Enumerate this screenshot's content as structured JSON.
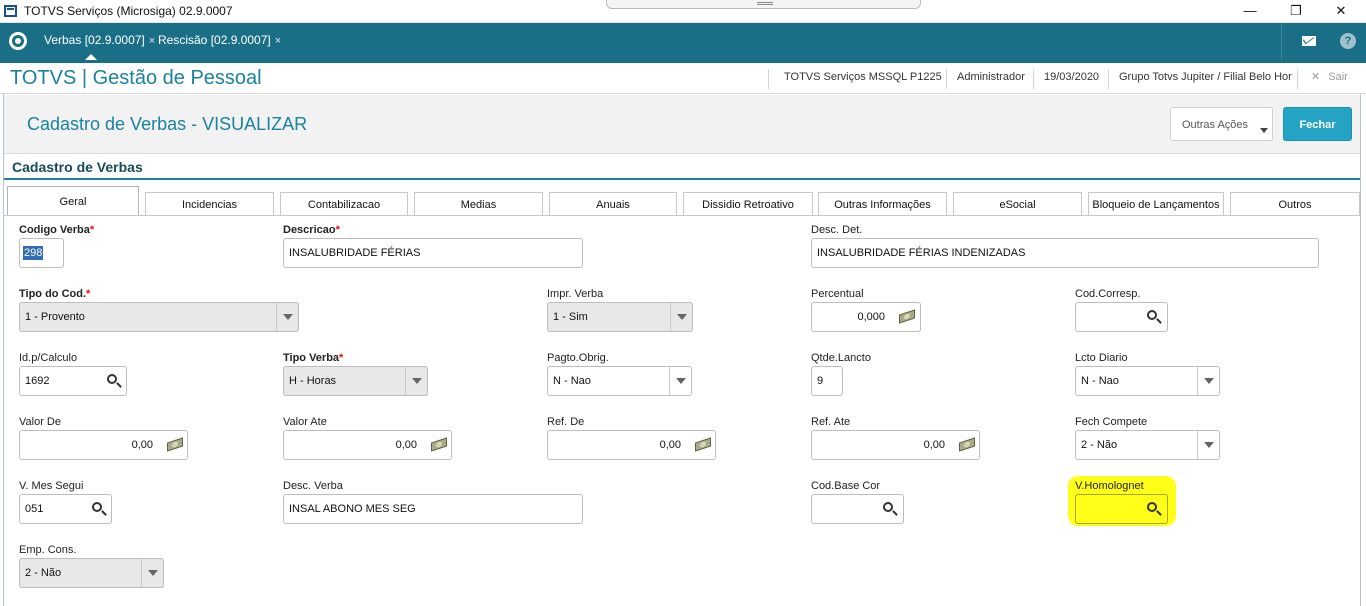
{
  "window": {
    "title": "TOTVS Serviços (Microsiga) 02.9.0007",
    "min": "—",
    "restore": "❐",
    "close": "✕"
  },
  "appbar": {
    "tabs": [
      {
        "label": "Verbas [02.9.0007]",
        "close": "×"
      },
      {
        "label": "Rescisão [02.9.0007]",
        "close": "×"
      }
    ],
    "help": "?"
  },
  "module": {
    "title": "TOTVS | Gestão de Pessoal",
    "server": "TOTVS Serviços MSSQL P1225",
    "user": "Administrador",
    "date": "19/03/2020",
    "branch": "Grupo Totvs Jupiter / Filial Belo Hor",
    "exit": "Sair",
    "exit_icon": "✕"
  },
  "page": {
    "title": "Cadastro de Verbas - VISUALIZAR",
    "other_actions": "Outras Ações",
    "close_button": "Fechar",
    "section": "Cadastro de Verbas"
  },
  "tabs": [
    "Geral",
    "Incidencias",
    "Contabilizacao",
    "Medias",
    "Anuais",
    "Dissidio Retroativo",
    "Outras Informações",
    "eSocial",
    "Bloqueio de Lançamentos",
    "Outros"
  ],
  "required_mark": "*",
  "fields": {
    "codigo_verba": {
      "label": "Codigo Verba",
      "value": "298"
    },
    "descricao": {
      "label": "Descricao",
      "value": "INSALUBRIDADE FÉRIAS"
    },
    "desc_det": {
      "label": "Desc. Det.",
      "value": "INSALUBRIDADE FÉRIAS INDENIZADAS"
    },
    "tipo_cod": {
      "label": "Tipo do Cod.",
      "value": "1 - Provento"
    },
    "impr_verba": {
      "label": "Impr. Verba",
      "value": "1 - Sim"
    },
    "percentual": {
      "label": "Percentual",
      "value": "0,000"
    },
    "cod_corresp": {
      "label": "Cod.Corresp.",
      "value": ""
    },
    "id_calculo": {
      "label": "Id.p/Calculo",
      "value": "1692"
    },
    "tipo_verba": {
      "label": "Tipo Verba",
      "value": "H - Horas"
    },
    "pagto_obrig": {
      "label": "Pagto.Obrig.",
      "value": "N - Nao"
    },
    "qtde_lancto": {
      "label": "Qtde.Lancto",
      "value": "9"
    },
    "lcto_diario": {
      "label": "Lcto Diario",
      "value": "N - Nao"
    },
    "valor_de": {
      "label": "Valor De",
      "value": "0,00"
    },
    "valor_ate": {
      "label": "Valor Ate",
      "value": "0,00"
    },
    "ref_de": {
      "label": "Ref. De",
      "value": "0,00"
    },
    "ref_ate": {
      "label": "Ref. Ate",
      "value": "0,00"
    },
    "fech_compete": {
      "label": "Fech Compete",
      "value": "2 - Não"
    },
    "v_mes_segui": {
      "label": "V. Mes Segui",
      "value": "051"
    },
    "desc_verba": {
      "label": "Desc. Verba",
      "value": "INSAL ABONO MES SEG"
    },
    "cod_base_cor": {
      "label": "Cod.Base Cor",
      "value": ""
    },
    "v_homolognet": {
      "label": "V.Homolognet",
      "value": ""
    },
    "emp_cons": {
      "label": "Emp. Cons.",
      "value": "2 - Não"
    }
  }
}
